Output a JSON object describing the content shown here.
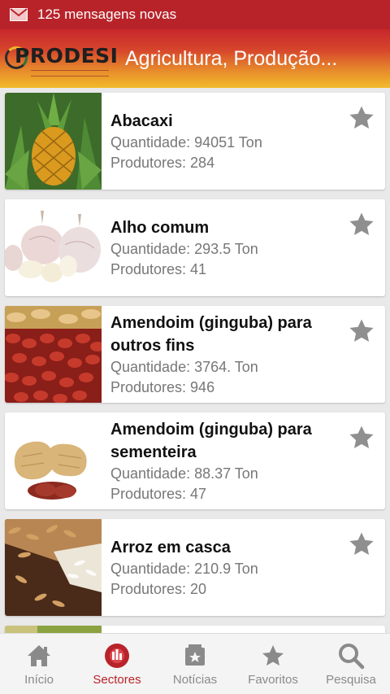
{
  "status_bar": {
    "notification_text": "125 mensagens novas",
    "icon": "mail-icon"
  },
  "header": {
    "logo_text": "PRODESI",
    "title": "Agricultura, Produção..."
  },
  "products": [
    {
      "name": "Abacaxi",
      "quantidade": "Quantidade: 94051 Ton",
      "produtores": "Produtores: 284"
    },
    {
      "name": "Alho comum",
      "quantidade": "Quantidade: 293.5 Ton",
      "produtores": "Produtores: 41"
    },
    {
      "name": "Amendoim (ginguba) para outros fins",
      "quantidade": "Quantidade: 3764. Ton",
      "produtores": "Produtores: 946"
    },
    {
      "name": "Amendoim (ginguba) para sementeira",
      "quantidade": "Quantidade: 88.37 Ton",
      "produtores": "Produtores: 47"
    },
    {
      "name": "Arroz em casca",
      "quantidade": "Quantidade: 210.9 Ton",
      "produtores": "Produtores: 20"
    }
  ],
  "nav": {
    "items": [
      {
        "label": "Início",
        "icon": "home-icon"
      },
      {
        "label": "Sectores",
        "icon": "sectors-icon",
        "active": true
      },
      {
        "label": "Notícias",
        "icon": "news-icon"
      },
      {
        "label": "Favoritos",
        "icon": "star-icon"
      },
      {
        "label": "Pesquisa",
        "icon": "search-icon"
      }
    ]
  },
  "colors": {
    "primary": "#b8232a",
    "accent_yellow": "#f2bb2a",
    "star_gray": "#8f8f8f"
  }
}
